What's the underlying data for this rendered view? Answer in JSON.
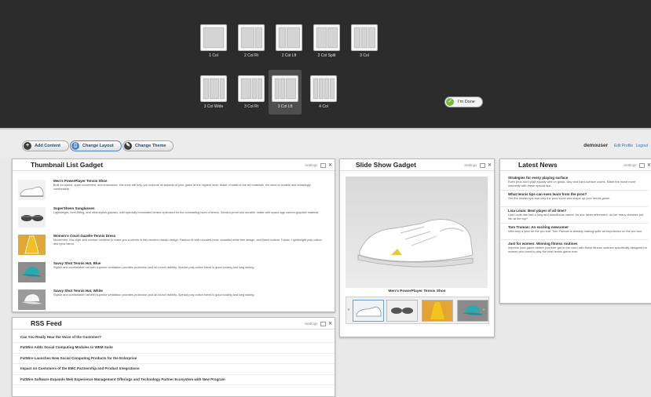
{
  "layouts": [
    {
      "label": "1 Col"
    },
    {
      "label": "2 Col Rt"
    },
    {
      "label": "2 Col Lft"
    },
    {
      "label": "2 Col Split"
    },
    {
      "label": "3 Col"
    },
    {
      "label": "3 Col Wide"
    },
    {
      "label": "3 Col Rt"
    },
    {
      "label": "3 Col Lft",
      "selected": true
    },
    {
      "label": "4 Col"
    }
  ],
  "done_button": "I'm Done",
  "toolbar": {
    "add": "Add Content",
    "layout": "Change Layout",
    "theme": "Change Theme"
  },
  "user": {
    "name": "demouser",
    "edit": "Edit Profile",
    "logout": "Logout"
  },
  "gadget_controls": {
    "settings": "Settings",
    "close": "✕"
  },
  "thumbnail_gadget": {
    "title": "Thumbnail List Gadget",
    "items": [
      {
        "title": "Men's PowerPlayer Tennis Shoe",
        "desc": "Built for speed, quick movement, and endurance, this shoe will help you execute all aspects of your game at the highest level. Made of state-of-the art materials, the shoe is durable and amazingly comfortable."
      },
      {
        "title": "SuperSheen Sunglasses",
        "desc": "Lightweight, form-fitting, and ultra-stylish glasses, with specially formulated lenses optimized for the contrasting hues of tennis. Scratch-proof and durable, made with space-age carbon-graphite material."
      },
      {
        "title": "Women's Court Gazelle Tennis Dress",
        "desc": "Movement, chic style and comfort combine to make you a winner in this modern classic design. Fashion fit with rounded-neck, beautiful white trim design, and flared bottom. Fabric: Lightweight poly-cotton and lycra blend."
      },
      {
        "title": "Savvy Shot Tennis Hat, Blue",
        "desc": "Stylish and comfortable hat with superior ventilation provides protection and all-round visibility. Special poly-cotton blend is good looking and long lasting."
      },
      {
        "title": "Savvy Shot Tennis Hat, White",
        "desc": "Stylish and comfortable hat with superior ventilation provides protection and all-round visibility. Special poly-cotton blend is good looking and long lasting."
      }
    ]
  },
  "rss": {
    "title": "RSS Feed",
    "items": [
      "Can You Really Hear the Voice of the Customer?",
      "FatWire Adds Social Computing Modules to WEM Suite",
      "FatWire Launches New Social Computing Products for the Enterprise",
      "Impact on Customers of the EMC Partnership and Product Integrations",
      "FatWire Software Expands Web Experience Management Offerings and Technology Partner Ecosystem with New Program"
    ]
  },
  "slideshow": {
    "title": "Slide Show Gadget",
    "caption": "Men's PowerPlayer Tennis Shoe",
    "prev": "◂",
    "next": "▸"
  },
  "news": {
    "title": "Latest News",
    "items": [
      {
        "title": "Strategies for every playing surface",
        "desc": "Even pros don't play equally well on grass, clay and hard-surface courts. Make the move more smoothly with these special tips."
      },
      {
        "title": "What tennis tips can even learn from the pros?",
        "desc": "Get the insider tips that only the pros know and shape up your tennis game."
      },
      {
        "title": "Lisa Louis: Best player of all time?",
        "desc": "Lisa Louis has had a long and tumultuous career. As she faces retirement, do her many victories put her at the top?"
      },
      {
        "title": "Tom Truman: An exciting newcomer",
        "desc": "With only a year on the pro tour, Tom Truman is already making quite an impression on the pro tour."
      },
      {
        "title": "Just for women: Winning fitness routines",
        "desc": "Improve your game before you ever get to the court with these fitness routines specifically designed for women who want to play the best tennis game ever."
      }
    ]
  }
}
